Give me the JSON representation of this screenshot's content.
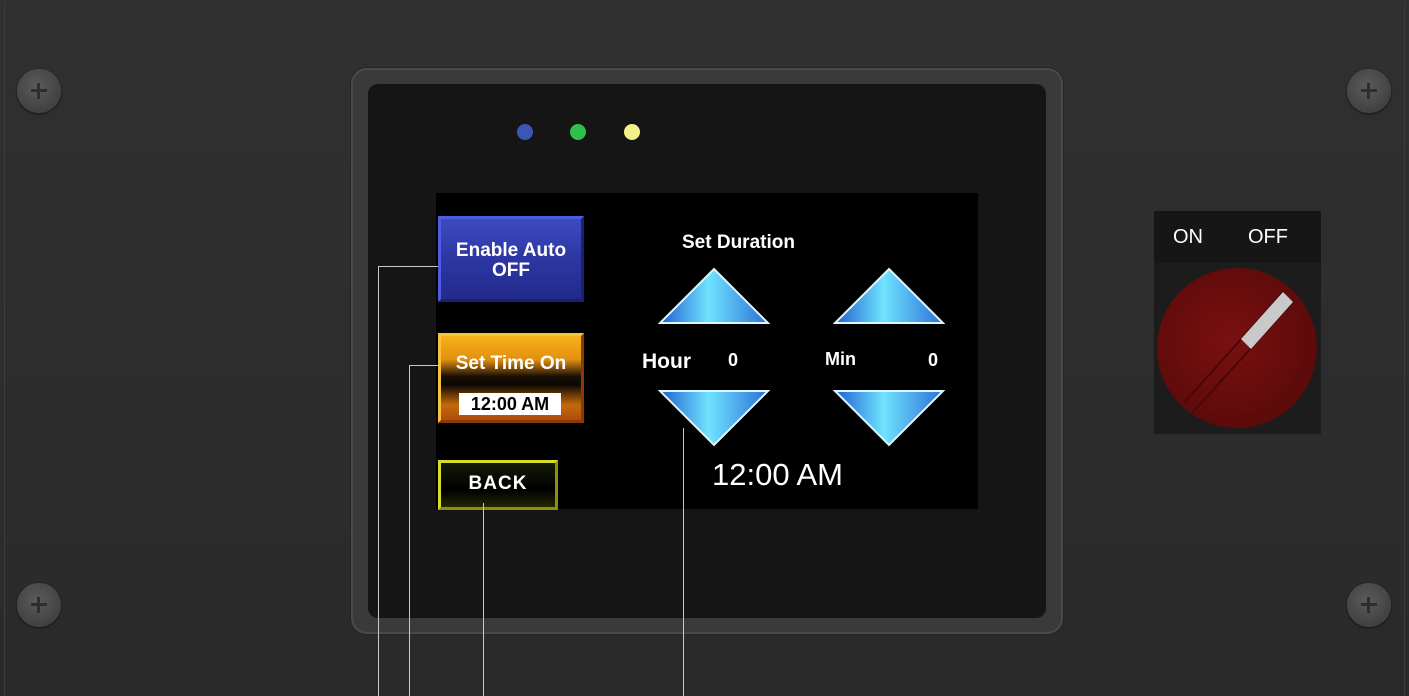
{
  "hmi": {
    "enable_auto": {
      "line1": "Enable Auto",
      "line2": "OFF"
    },
    "set_time_on": {
      "label": "Set Time On",
      "value": "12:00 AM"
    },
    "back_label": "BACK",
    "set_duration_title": "Set Duration",
    "hour": {
      "label": "Hour",
      "value": "0"
    },
    "min": {
      "label": "Min",
      "value": "0"
    },
    "current_time": "12:00 AM"
  },
  "selector_switch": {
    "on_label": "ON",
    "off_label": "OFF",
    "position": "OFF"
  },
  "colors": {
    "led_blue": "#3a57b5",
    "led_green": "#2fbf4a",
    "led_yellow": "#f4f08a",
    "knob_red": "#6b0d0d"
  }
}
